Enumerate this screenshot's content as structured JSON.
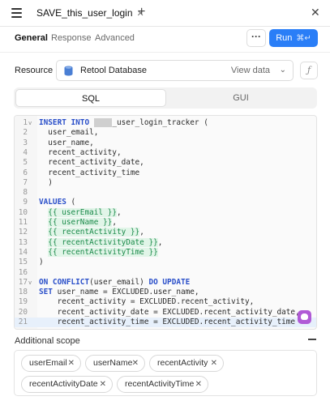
{
  "tab": {
    "name": "SAVE_this_user_login",
    "close": "✕",
    "new_tab": "+"
  },
  "window": {
    "close": "✕"
  },
  "subnav": {
    "tabs": [
      "General",
      "Response",
      "Advanced"
    ],
    "active": "General"
  },
  "toolbar": {
    "more_label": "···",
    "run_label": "Run",
    "run_shortcut": "⌘↵"
  },
  "resource": {
    "label": "Resource",
    "name": "Retool Database",
    "view_data": "View data",
    "fx": "ƒ"
  },
  "mode": {
    "options": [
      "SQL",
      "GUI"
    ],
    "active": "SQL"
  },
  "editor": {
    "line_numbers": [
      "1",
      "2",
      "3",
      "4",
      "5",
      "6",
      "7",
      "8",
      "9",
      "10",
      "11",
      "12",
      "13",
      "14",
      "15",
      "16",
      "17",
      "18",
      "19",
      "20",
      "21"
    ],
    "redacted_table_prefix": "████",
    "active_line": 21
  },
  "additional_scope": {
    "label": "Additional scope",
    "chips": [
      "userEmail",
      "userName",
      "recentActivity",
      "recentActivityDate",
      "recentActivityTime"
    ]
  },
  "colors": {
    "accent": "#2a7ef7",
    "keyword": "#2a4fc9",
    "template": "#1b8a4a",
    "assist": "#b05ad6"
  }
}
